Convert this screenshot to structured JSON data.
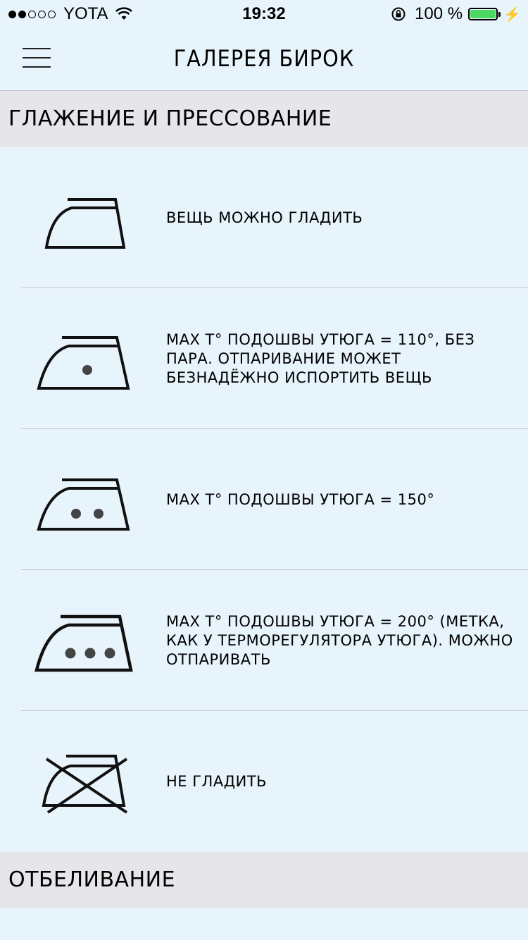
{
  "status_bar": {
    "carrier": "YOTA",
    "time": "19:32",
    "battery_percent": "100 %",
    "signal_bars_filled": 2,
    "signal_bars_total": 5
  },
  "nav": {
    "title": "ГАЛЕРЕЯ БИРОК",
    "menu_icon": "hamburger-menu-icon"
  },
  "sections": [
    {
      "title": "ГЛАЖЕНИЕ И ПРЕССОВАНИЕ",
      "items": [
        {
          "icon": "iron-icon",
          "dots": 0,
          "crossed": false,
          "text": "ВЕЩЬ МОЖНО ГЛАДИТЬ"
        },
        {
          "icon": "iron-one-dot-icon",
          "dots": 1,
          "crossed": false,
          "text": "MAX T° ПОДОШВЫ УТЮГА = 110°, БЕЗ ПАРА. ОТПАРИВАНИЕ МОЖЕТ БЕЗНАДЁЖНО ИСПОРТИТЬ ВЕЩЬ"
        },
        {
          "icon": "iron-two-dots-icon",
          "dots": 2,
          "crossed": false,
          "text": "MAX T° ПОДОШВЫ УТЮГА = 150°"
        },
        {
          "icon": "iron-three-dots-icon",
          "dots": 3,
          "crossed": false,
          "text": "MAX T° ПОДОШВЫ УТЮГА = 200° (МЕТКА, КАК У ТЕРМОРЕГУЛЯТОРА УТЮГА). МОЖНО ОТПАРИВАТЬ"
        },
        {
          "icon": "iron-crossed-icon",
          "dots": 0,
          "crossed": true,
          "text": "НЕ ГЛАДИТЬ"
        }
      ]
    },
    {
      "title": "ОТБЕЛИВАНИЕ",
      "items": []
    }
  ],
  "colors": {
    "background": "#e8f4fc",
    "section_header": "#e6e6ea",
    "battery": "#4cd964"
  }
}
